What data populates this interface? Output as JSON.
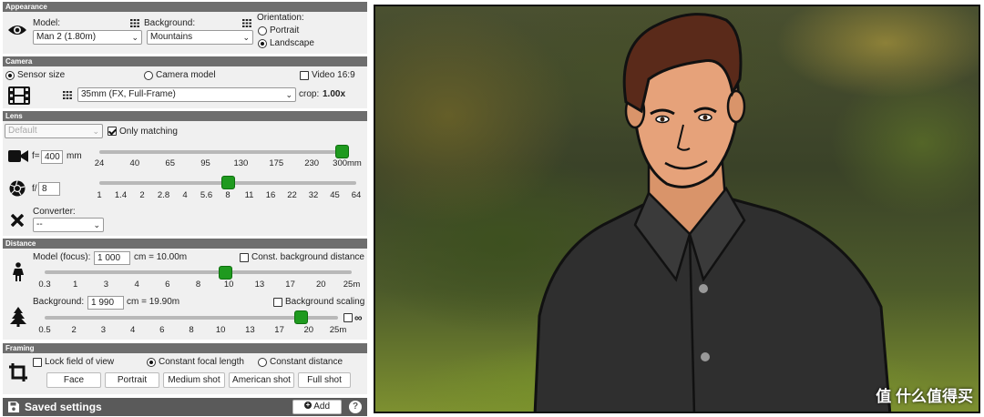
{
  "appearance": {
    "header": "Appearance",
    "model_label": "Model:",
    "model_value": "Man 2 (1.80m)",
    "background_label": "Background:",
    "background_value": "Mountains",
    "orientation_label": "Orientation:",
    "portrait": "Portrait",
    "landscape": "Landscape",
    "orientation_selected": "Landscape"
  },
  "camera": {
    "header": "Camera",
    "sensor_size": "Sensor size",
    "camera_model": "Camera model",
    "video": "Video 16:9",
    "selected_mode": "Sensor size",
    "video_checked": false,
    "sensor_value": "35mm (FX, Full-Frame)",
    "crop_label": "crop:",
    "crop_value": "1.00x"
  },
  "lens": {
    "header": "Lens",
    "preset_value": "Default",
    "only_matching": "Only matching",
    "only_matching_checked": true,
    "focal_prefix": "f=",
    "focal_value": "400",
    "focal_unit": "mm",
    "focal_ticks": [
      "24",
      "40",
      "65",
      "95",
      "130",
      "175",
      "230",
      "300mm"
    ],
    "focal_slider_fraction": 1.0,
    "aperture_prefix": "f/",
    "aperture_value": "8",
    "aperture_ticks": [
      "1",
      "1.4",
      "2",
      "2.8",
      "4",
      "5.6",
      "8",
      "11",
      "16",
      "22",
      "32",
      "45",
      "64"
    ],
    "aperture_slider_fraction": 0.5,
    "converter_label": "Converter:",
    "converter_value": "--"
  },
  "distance": {
    "header": "Distance",
    "model_focus_label": "Model (focus):",
    "model_focus_value": "1 000",
    "model_focus_unit": "cm = 10.00m",
    "const_bg": "Const. background distance",
    "const_bg_checked": false,
    "model_ticks": [
      "0.3",
      "1",
      "3",
      "4",
      "6",
      "8",
      "10",
      "13",
      "17",
      "20",
      "25m"
    ],
    "model_slider_fraction": 0.589,
    "background_label": "Background:",
    "background_value": "1 990",
    "background_unit": "cm = 19.90m",
    "bg_scaling": "Background scaling",
    "bg_scaling_checked": false,
    "bg_ticks": [
      "0.5",
      "2",
      "3",
      "4",
      "6",
      "8",
      "10",
      "13",
      "17",
      "20",
      "25m"
    ],
    "bg_slider_fraction": 0.875,
    "infinity": "∞",
    "infinity_checked": false
  },
  "framing": {
    "header": "Framing",
    "lock_fov": "Lock field of view",
    "lock_fov_checked": false,
    "const_focal": "Constant focal length",
    "const_distance": "Constant distance",
    "selected": "Constant focal length",
    "buttons": [
      "Face",
      "Portrait",
      "Medium shot",
      "American shot",
      "Full shot"
    ]
  },
  "saved": {
    "label": "Saved settings",
    "add_button": "Add",
    "help": "?"
  },
  "watermark": "值 什么值得买",
  "colors": {
    "slider_thumb": "#1f9a1f",
    "section_header": "#6e6e6e",
    "saved_bar": "#5a5a5a"
  }
}
